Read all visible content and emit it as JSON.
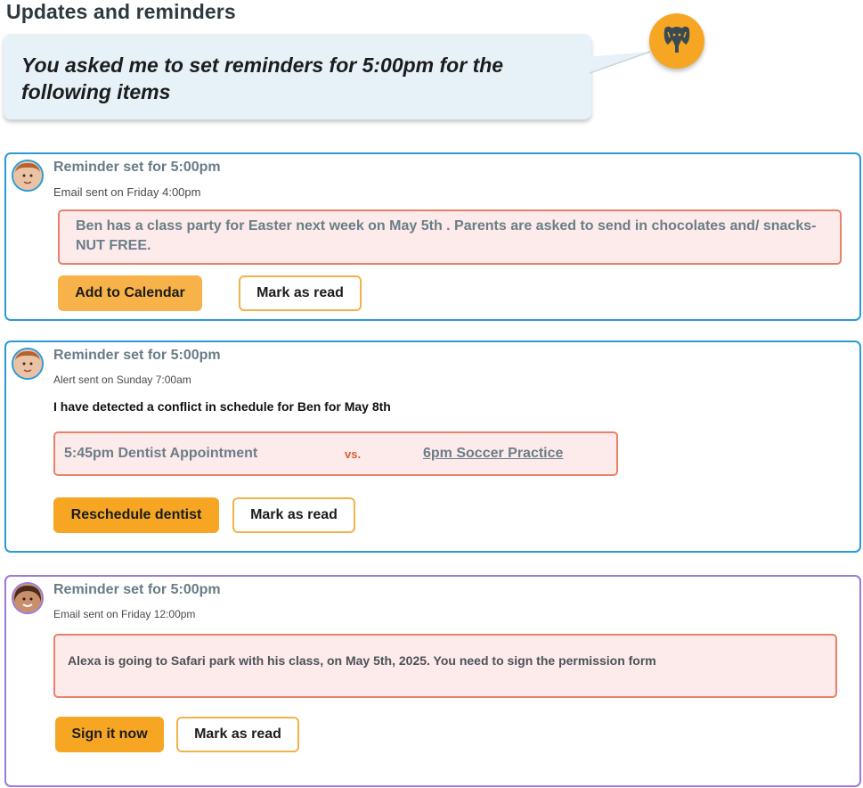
{
  "page": {
    "title": "Updates and reminders"
  },
  "assistant": {
    "message": "You asked me to set reminders for 5:00pm for the following items",
    "avatar_icon": "elephant-icon",
    "avatar_color": "#f6a623"
  },
  "cards": [
    {
      "reminder_label": "Reminder set for 5:00pm",
      "sent_text": "Email sent on Friday 4:00pm",
      "note": "Ben has a class party for Easter next week on May 5th . Parents are asked to send in chocolates and/ snacks-NUT FREE.",
      "primary_button": "Add to Calendar",
      "secondary_button": "Mark as read",
      "border_color": "#2a9ad8"
    },
    {
      "reminder_label": "Reminder set for 5:00pm",
      "sent_text": "Alert sent on Sunday 7:00am",
      "conflict_text": "I have detected a conflict in schedule for Ben for May 8th",
      "conflict": {
        "left": "5:45pm Dentist Appointment",
        "vs": "vs.",
        "right": "6pm Soccer Practice"
      },
      "primary_button": "Reschedule dentist",
      "secondary_button": "Mark as read",
      "border_color": "#2a9ad8"
    },
    {
      "reminder_label": "Reminder set for 5:00pm",
      "sent_text": "Email sent on Friday 12:00pm",
      "note": "Alexa is going to Safari park with his class, on May 5th, 2025. You need to sign the permission form",
      "primary_button": "Sign it now",
      "secondary_button": "Mark as read",
      "border_color": "#9a7bd8"
    }
  ],
  "colors": {
    "accent": "#f6a623",
    "note_background": "#fdeaea",
    "note_border": "#e8806a",
    "bubble_background": "#e6f2f8"
  }
}
